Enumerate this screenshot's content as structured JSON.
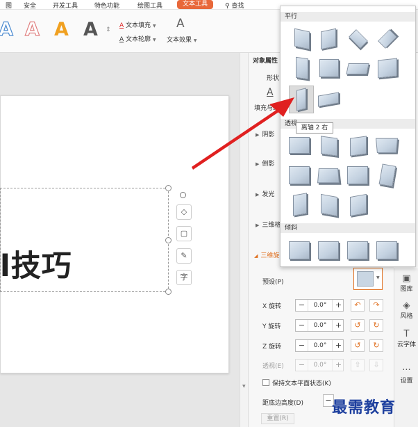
{
  "menubar": {
    "items": [
      "图",
      "安全",
      "开发工具",
      "特色功能",
      "绘图工具"
    ],
    "active_tab": "文本工具",
    "search": "查找"
  },
  "ribbon": {
    "wordart_glyphs": [
      "A",
      "A",
      "A",
      "A"
    ],
    "text_fill": "文本填充",
    "text_outline": "文本轮廓",
    "text_effect": "文本效果",
    "text_effect_glyph": "A"
  },
  "canvas": {
    "title_text": "l技巧",
    "tool_glyphs": [
      "◇",
      "▢",
      "✎",
      "字"
    ]
  },
  "panel": {
    "header": "对象属性",
    "subtab": "形状",
    "fill_outline": "填充与线",
    "fill_glyph": "A",
    "sections": [
      "阴影",
      "倒影",
      "发光",
      "三维格",
      "三维旋"
    ],
    "preset_label": "预设(P)",
    "x_rot_label": "X 旋转",
    "x_rot_value": "0.0°",
    "y_rot_label": "Y 旋转",
    "y_rot_value": "0.0°",
    "z_rot_label": "Z 旋转",
    "z_rot_value": "0.0°",
    "perspective_label": "透视(E)",
    "perspective_value": "0.0°",
    "keep_flat_label": "保持文本平面状态(K)",
    "distance_label": "距底边高度(D)",
    "reset_label": "重置(R)"
  },
  "dock": {
    "items": [
      {
        "icon": "image-library-icon",
        "label": "图库",
        "glyph": "▣"
      },
      {
        "icon": "style-icon",
        "label": "风格",
        "glyph": "◈"
      },
      {
        "icon": "cloud-font-icon",
        "label": "云字体",
        "glyph": "T"
      },
      {
        "icon": "more-icon",
        "label": "设置",
        "glyph": "···"
      }
    ]
  },
  "gallery": {
    "sections": [
      "平行",
      "透视",
      "倾斜"
    ],
    "tooltip": "离轴 2 右"
  },
  "watermark": "最需教育",
  "colors": {
    "accent": "#e8683a",
    "arrow": "#e02020",
    "tile": "#c9d6e3",
    "watermark": "#1d3f9e"
  }
}
